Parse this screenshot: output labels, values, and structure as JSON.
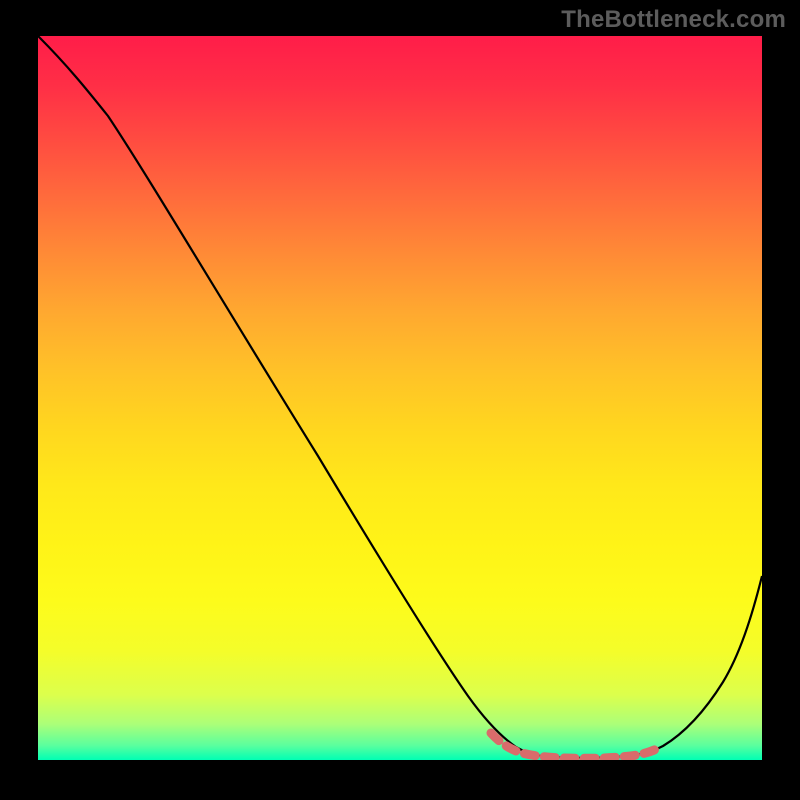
{
  "watermark": "TheBottleneck.com",
  "chart_data": {
    "type": "line",
    "title": "",
    "xlabel": "",
    "ylabel": "",
    "xlim": [
      0,
      100
    ],
    "ylim": [
      0,
      100
    ],
    "x": [
      0,
      2,
      6,
      12,
      20,
      30,
      40,
      50,
      58,
      62,
      65,
      68,
      72,
      76,
      80,
      84,
      88,
      92,
      96,
      100
    ],
    "values": [
      100,
      98,
      95,
      88,
      77,
      63,
      49,
      35,
      22,
      14,
      8,
      3,
      1,
      0.3,
      0.3,
      1,
      4,
      10,
      20,
      33
    ],
    "highlight_segment": {
      "color": "#d96b6b",
      "x": [
        62,
        65,
        68,
        72,
        76,
        80,
        84
      ],
      "values": [
        2.4,
        1.0,
        0.4,
        0.2,
        0.2,
        0.5,
        1.5
      ]
    },
    "gradient_colors_top_to_bottom": [
      "#ff1d49",
      "#ff4a41",
      "#ff8a36",
      "#ffc128",
      "#ffe81a",
      "#fdfb1b",
      "#dcff4c",
      "#5aff9e",
      "#00ffb4"
    ]
  }
}
